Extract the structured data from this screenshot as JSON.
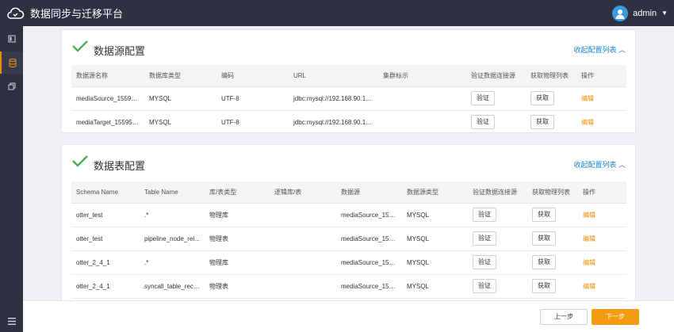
{
  "app": {
    "title": "数据同步与迁移平台"
  },
  "user": {
    "name": "admin"
  },
  "sidebar": {
    "items": [
      {
        "icon": "book-icon",
        "active": false
      },
      {
        "icon": "database-icon",
        "active": true
      },
      {
        "icon": "copy-icon",
        "active": false
      }
    ],
    "bottom_icon": "menu-icon"
  },
  "datasource_section": {
    "title": "数据源配置",
    "collapse_label": "收起配置列表",
    "columns": [
      "数据源名称",
      "数据库类型",
      "编码",
      "URL",
      "集群标示",
      "验证数据连接源",
      "获取物理列表",
      "操作"
    ],
    "rows": [
      {
        "name": "mediaSource_15595...",
        "db_type": "MYSQL",
        "encoding": "UTF-8",
        "url": "jdbc:mysql://192.168.90.12:...",
        "cluster": "",
        "verify": "验证",
        "fetch": "获取",
        "action": "编辑"
      },
      {
        "name": "mediaTarget_155956...",
        "db_type": "MYSQL",
        "encoding": "UTF-8",
        "url": "jdbc:mysql://192.168.90.14:...",
        "cluster": "",
        "verify": "验证",
        "fetch": "获取",
        "action": "编辑"
      }
    ]
  },
  "table_section": {
    "title": "数据表配置",
    "collapse_label": "收起配置列表",
    "columns": [
      "Schema Name",
      "Table Name",
      "库/表类型",
      "逻辑库/表",
      "数据源",
      "数据源类型",
      "验证数据连接源",
      "获取物理列表",
      "操作"
    ],
    "rows": [
      {
        "schema": "otter_test",
        "table": ".*",
        "kind": "物理库",
        "logical": "",
        "source": "mediaSource_155...",
        "source_type": "MYSQL",
        "verify": "验证",
        "fetch": "获取",
        "action": "编辑"
      },
      {
        "schema": "otter_test",
        "table": "pipeline_node_rel...",
        "kind": "物理表",
        "logical": "",
        "source": "mediaSource_155...",
        "source_type": "MYSQL",
        "verify": "验证",
        "fetch": "获取",
        "action": "编辑"
      },
      {
        "schema": "otter_2_4_1",
        "table": ".*",
        "kind": "物理库",
        "logical": "",
        "source": "mediaSource_155...",
        "source_type": "MYSQL",
        "verify": "验证",
        "fetch": "获取",
        "action": "编辑"
      },
      {
        "schema": "otter_2_4_1",
        "table": "syncall_table_record",
        "kind": "物理表",
        "logical": "",
        "source": "mediaSource_155...",
        "source_type": "MYSQL",
        "verify": "验证",
        "fetch": "获取",
        "action": "编辑"
      }
    ]
  },
  "footer": {
    "prev_label": "上一步",
    "next_label": "下一步"
  },
  "colors": {
    "topbar": "#2d3142",
    "accent": "#f39c12",
    "link": "#1b86d6",
    "check": "#4caf50"
  }
}
